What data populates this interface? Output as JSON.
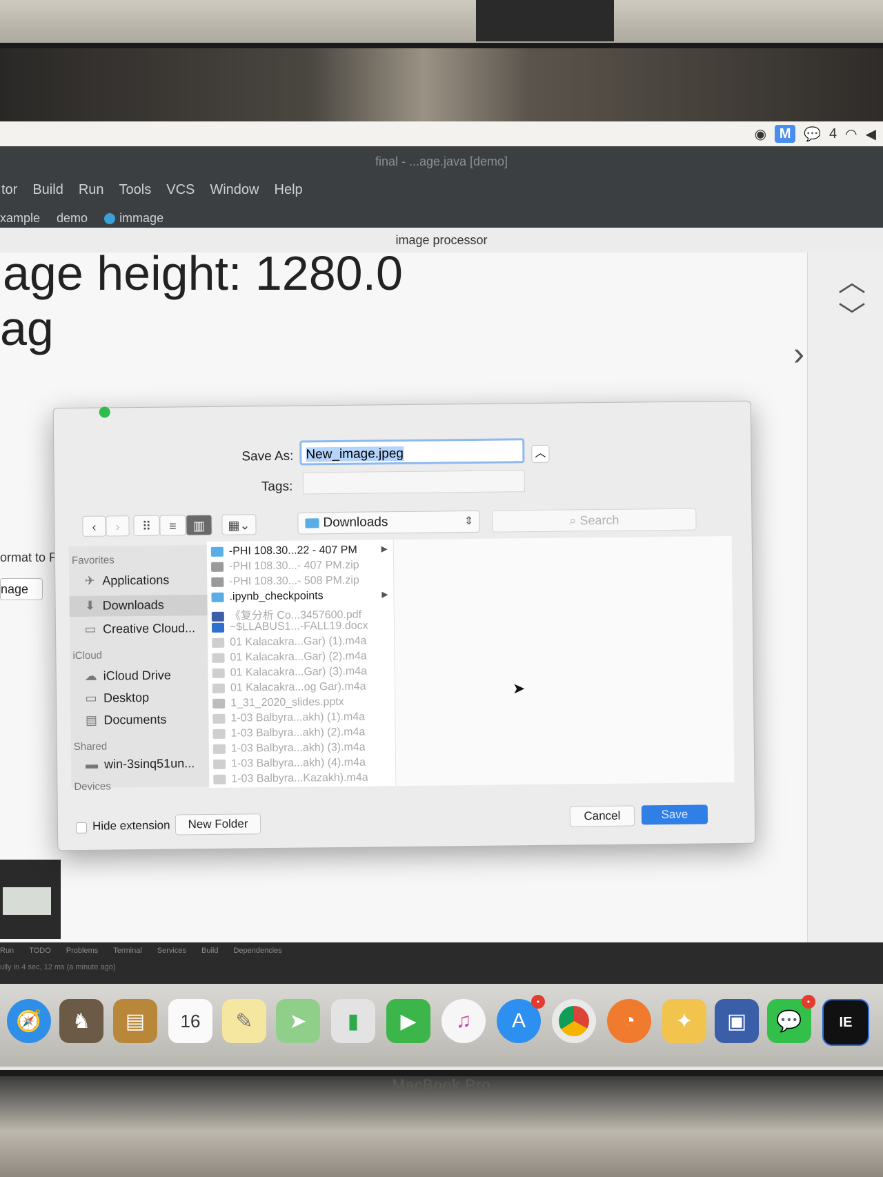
{
  "menubar": {
    "status_icons": [
      "color-sync-icon",
      "malwarebytes-icon",
      "wechat-icon",
      "wifi-icon",
      "volume-icon"
    ],
    "wechat_count": "4"
  },
  "ide": {
    "window_title": "final - ...age.java [demo]",
    "menu": [
      "tor",
      "Build",
      "Run",
      "Tools",
      "VCS",
      "Window",
      "Help"
    ],
    "breadcrumb": [
      "xample",
      "demo",
      "immage"
    ]
  },
  "app": {
    "title": "image processor",
    "text_line_1": "age height: 1280.0",
    "text_line_2": "ag",
    "format_label": "ormat to PI",
    "image_button": "nage"
  },
  "dialog": {
    "save_as_label": "Save As:",
    "save_as_value": "New_image.jpeg",
    "tags_label": "Tags:",
    "tags_value": "",
    "location": "Downloads",
    "search_placeholder": "Search",
    "sidebar": {
      "favorites_heading": "Favorites",
      "favorites": [
        "Applications",
        "Downloads",
        "Creative Cloud..."
      ],
      "icloud_heading": "iCloud",
      "icloud": [
        "iCloud Drive",
        "Desktop",
        "Documents"
      ],
      "shared_heading": "Shared",
      "shared": [
        "win-3sinq51un..."
      ],
      "devices_heading": "Devices"
    },
    "files": [
      {
        "name": "-PHI 108.30...22 - 407 PM",
        "type": "folder",
        "enabled": true
      },
      {
        "name": "-PHI 108.30...- 407 PM.zip",
        "type": "zip",
        "enabled": false
      },
      {
        "name": "-PHI 108.30...- 508 PM.zip",
        "type": "zip",
        "enabled": false
      },
      {
        "name": ".ipynb_checkpoints",
        "type": "folder",
        "enabled": true
      },
      {
        "name": "《复分析 Co...3457600.pdf",
        "type": "pdf",
        "enabled": false
      },
      {
        "name": "~$LLABUS1...-FALL19.docx",
        "type": "docx",
        "enabled": false
      },
      {
        "name": "01 Kalacakra...Gar) (1).m4a",
        "type": "audio",
        "enabled": false
      },
      {
        "name": "01 Kalacakra...Gar) (2).m4a",
        "type": "audio",
        "enabled": false
      },
      {
        "name": "01 Kalacakra...Gar) (3).m4a",
        "type": "audio",
        "enabled": false
      },
      {
        "name": "01 Kalacakra...og Gar).m4a",
        "type": "audio",
        "enabled": false
      },
      {
        "name": "1_31_2020_slides.pptx",
        "type": "pptx",
        "enabled": false
      },
      {
        "name": "1-03 Balbyra...akh) (1).m4a",
        "type": "audio",
        "enabled": false
      },
      {
        "name": "1-03 Balbyra...akh) (2).m4a",
        "type": "audio",
        "enabled": false
      },
      {
        "name": "1-03 Balbyra...akh) (3).m4a",
        "type": "audio",
        "enabled": false
      },
      {
        "name": "1-03 Balbyra...akh) (4).m4a",
        "type": "audio",
        "enabled": false
      },
      {
        "name": "1-03 Balbyra...Kazakh).m4a",
        "type": "audio",
        "enabled": false
      }
    ],
    "hide_extension_label": "Hide extension",
    "new_folder_label": "New Folder",
    "cancel_label": "Cancel",
    "save_label": "Save"
  },
  "ide_bottom": {
    "tool_tabs": [
      "Run",
      "TODO",
      "Problems",
      "Terminal",
      "Services",
      "Build",
      "Dependencies"
    ],
    "status": "ully in 4 sec, 12 ms (a minute ago)"
  },
  "dock": {
    "apps": [
      "safari-icon",
      "chess-icon",
      "notefile-icon",
      "calendar-icon",
      "notes-icon",
      "maps-icon",
      "numbers-icon",
      "facetime-icon",
      "itunes-icon",
      "app-store-icon",
      "chrome-icon",
      "firefox-icon",
      "stuffit-icon",
      "virtualbox-icon",
      "wechat-icon",
      "intellij-icon"
    ],
    "calendar_day": "16",
    "intellij_text": "IE"
  },
  "laptop_label": "MacBook Pro"
}
